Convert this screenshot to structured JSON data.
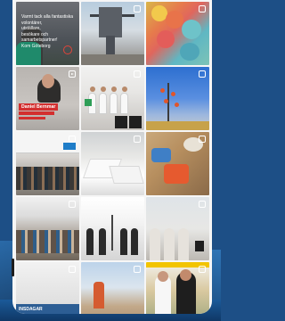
{
  "colors": {
    "background": "#1d4f86",
    "phone_bg": "#f6f6f6",
    "name_tag": "#d32f2f",
    "band": "#2d5e94"
  },
  "grid": {
    "columns": 3,
    "posts": [
      {
        "type": "image",
        "description_icon": "none",
        "overlay_lines": [
          "Varmt tack alla fantastiska",
          "volontärer,",
          "utställare,",
          "besökare och",
          "samarbetspartner!",
          "Kom Göteborg"
        ]
      },
      {
        "type": "image",
        "icon": "multi-image-icon"
      },
      {
        "type": "image",
        "icon": "multi-image-icon"
      },
      {
        "type": "reel",
        "icon": "reel-icon",
        "name_tag": "Daniel Bernmar"
      },
      {
        "type": "image",
        "icon": "multi-image-icon"
      },
      {
        "type": "image",
        "icon": "multi-image-icon"
      },
      {
        "type": "image",
        "icon": "multi-image-icon"
      },
      {
        "type": "image",
        "icon": "multi-image-icon"
      },
      {
        "type": "image",
        "icon": "multi-image-icon"
      },
      {
        "type": "image",
        "icon": "multi-image-icon"
      },
      {
        "type": "image",
        "icon": "none"
      },
      {
        "type": "image",
        "icon": "multi-image-icon"
      },
      {
        "type": "image",
        "icon": "multi-image-icon",
        "band_text": "INSDAGAR"
      },
      {
        "type": "image",
        "icon": "multi-image-icon"
      },
      {
        "type": "image",
        "icon": "multi-image-icon"
      }
    ]
  }
}
